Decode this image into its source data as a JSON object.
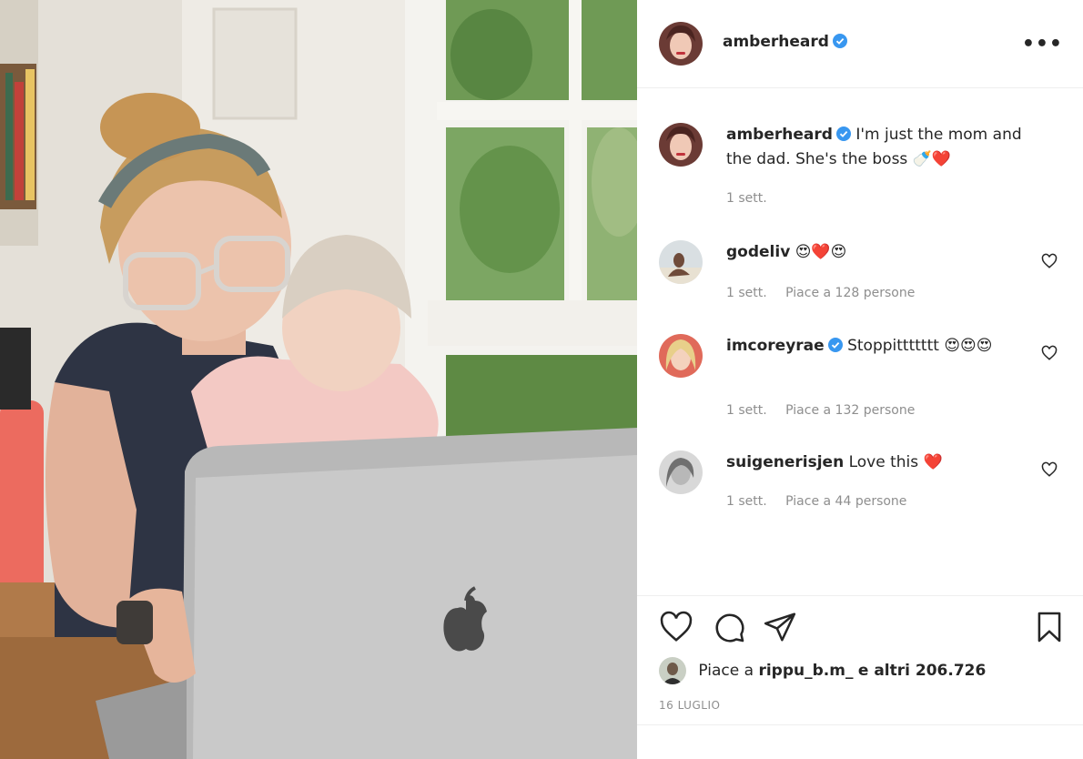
{
  "post": {
    "author": "amberheard",
    "more_label": "•••"
  },
  "caption": {
    "author": "amberheard",
    "text": "I'm just the mom and the dad. She's the boss 🍼❤️",
    "time": "1 sett."
  },
  "comments": [
    {
      "author": "godeliv",
      "text": "😍❤️😍",
      "time": "1 sett.",
      "likes": "Piace a 128 persone"
    },
    {
      "author": "imcoreyrae",
      "text": "Stoppittttttt 😍😍😍",
      "time": "1 sett.",
      "likes": "Piace a 132 persone"
    },
    {
      "author": "suigenerisjen",
      "text": "Love this ❤️",
      "time": "1 sett.",
      "likes": "Piace a 44 persone"
    }
  ],
  "likes_summary": {
    "prefix": "Piace a",
    "user": "rippu_b.m_",
    "suffix": "e altri 206.726"
  },
  "date": "16 LUGLIO",
  "colors": {
    "verified": "#3897f0",
    "heart_red": "#ed4956",
    "meta_gray": "#8e8e8e"
  },
  "icons": [
    "verified-badge-icon",
    "heart-icon",
    "comment-icon",
    "share-icon",
    "bookmark-icon",
    "more-icon"
  ]
}
